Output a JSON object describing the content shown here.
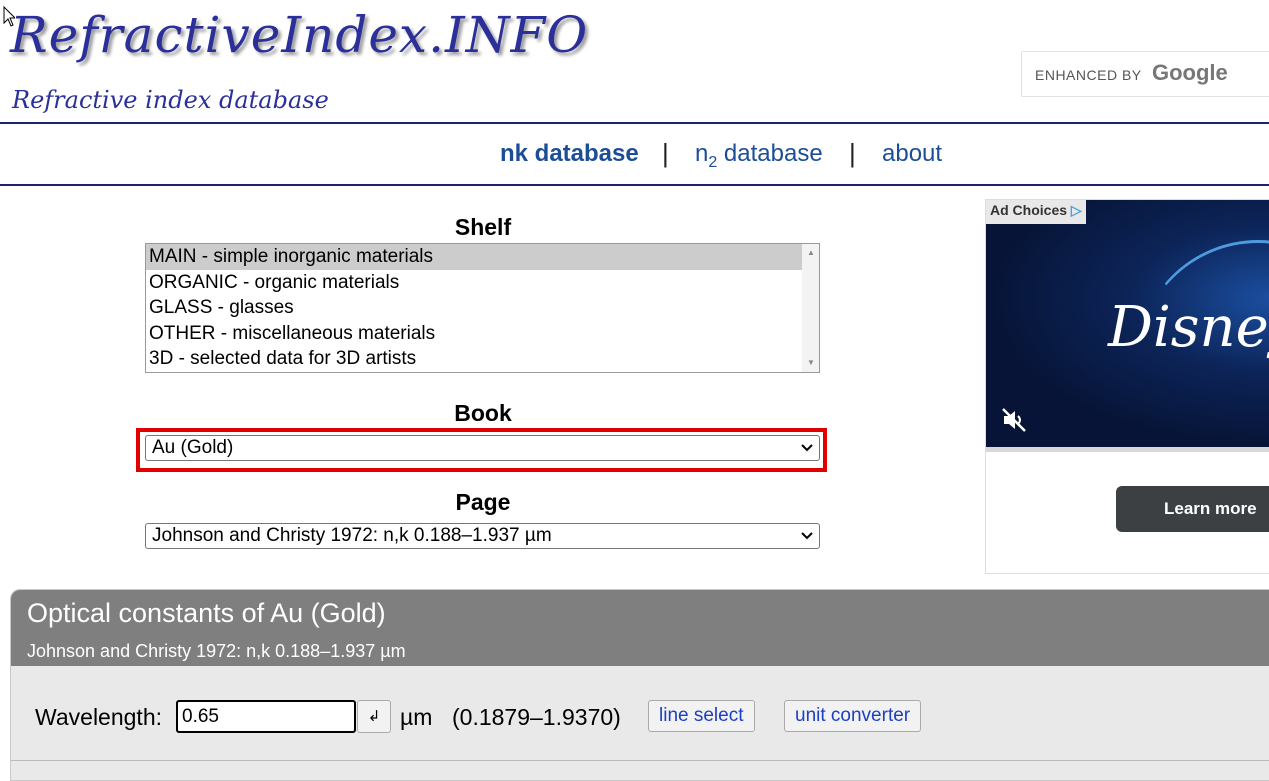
{
  "header": {
    "logo": "RefractiveIndex.INFO",
    "tagline": "Refractive index database",
    "search": {
      "small_label": "ENHANCED BY",
      "google_label": "Google"
    }
  },
  "nav": {
    "nk_label": "nk database",
    "n2_prefix": "n",
    "n2_sub": "2",
    "n2_suffix": " database",
    "about_label": "about",
    "separator": "|"
  },
  "shelf": {
    "title": "Shelf",
    "items": [
      "MAIN - simple inorganic materials",
      "ORGANIC - organic materials",
      "GLASS - glasses",
      "OTHER - miscellaneous materials",
      "3D - selected data for 3D artists"
    ],
    "selected_index": 0
  },
  "book": {
    "title": "Book",
    "value": "Au (Gold)",
    "highlight_color": "#e00000"
  },
  "page": {
    "title": "Page",
    "value": "Johnson and Christy 1972: n,k 0.188–1.937 µm"
  },
  "ad": {
    "choices_label": "Ad Choices",
    "brand": "Disney",
    "learn_more": "Learn more"
  },
  "panel": {
    "title": "Optical constants of Au (Gold)",
    "subtitle": "Johnson and Christy 1972: n,k 0.188–1.937 µm",
    "wavelength_label": "Wavelength:",
    "wavelength_value": "0.65",
    "enter_symbol": "↲",
    "unit": "µm",
    "range": "(0.1879–1.9370)",
    "line_select": "line select",
    "unit_converter": "unit converter"
  },
  "colors": {
    "link": "#1c4e98",
    "logo": "#2b2f99",
    "panel_header": "#7f7f7f",
    "button_text": "#1c3fc4"
  }
}
